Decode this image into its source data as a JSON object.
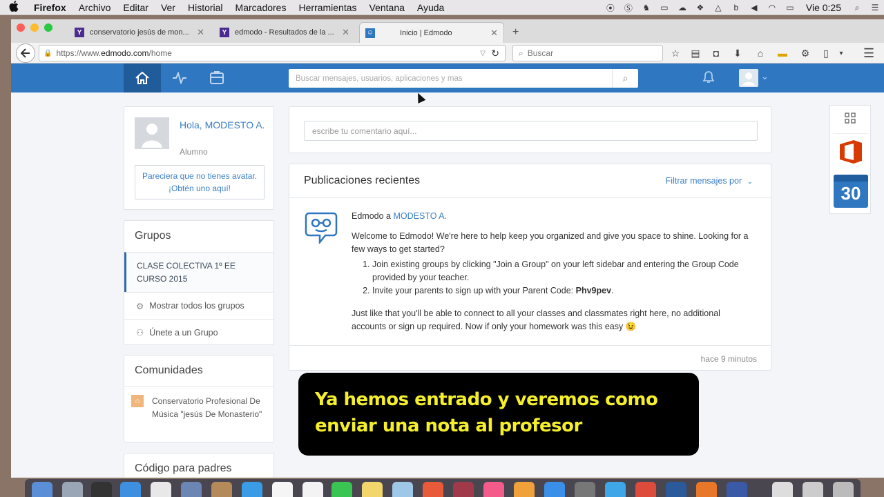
{
  "menubar": {
    "apple": "",
    "items": [
      "Firefox",
      "Archivo",
      "Editar",
      "Ver",
      "Historial",
      "Marcadores",
      "Herramientas",
      "Ventana",
      "Ayuda"
    ],
    "clock": "Vie 0:25"
  },
  "browser": {
    "tabs": [
      {
        "favicon": "Y",
        "title": "conservatorio jesús de mon..."
      },
      {
        "favicon": "Y",
        "title": "edmodo - Resultados de la ..."
      },
      {
        "favicon": "edmodo-icon",
        "title": "Inicio | Edmodo"
      }
    ],
    "new_tab": "+",
    "url_prefix": "https://www.",
    "url_domain": "edmodo.com",
    "url_path": "/home",
    "search_placeholder": "Buscar"
  },
  "edmodo": {
    "search_placeholder": "Buscar mensajes, usuarios, aplicaciones y mas",
    "profile": {
      "greeting": "Hola, MODESTO A.",
      "role": "Alumno",
      "avatar_cta": "Pareciera que no tienes avatar. ¡Obtén uno aquí!"
    },
    "groups": {
      "title": "Grupos",
      "active_group": "CLASE COLECTIVA 1º EE CURSO 2015",
      "show_all": "Mostrar todos los grupos",
      "join": "Únete a un Grupo"
    },
    "communities": {
      "title": "Comunidades",
      "item": "Conservatorio Profesional De Música \"jesús De Monasterio\""
    },
    "parent_code_title": "Código para padres",
    "composer_placeholder": "escribe tu comentario aquí...",
    "feed": {
      "title": "Publicaciones recientes",
      "filter": "Filtrar mensajes por",
      "post": {
        "sender": "Edmodo",
        "to": "a",
        "recipient": "MODESTO A.",
        "intro": "Welcome to Edmodo! We're here to help keep you organized and give you space to shine. Looking for a few ways to get started?",
        "step1": "Join existing groups by clicking \"Join a Group\" on your left sidebar and entering the Group Code provided by your teacher.",
        "step2_text": "Invite your parents to sign up with your Parent Code: ",
        "parent_code": "Phv9pev",
        "step2_end": ".",
        "outro": "Just like that you'll be able to connect to all your classes and classmates right here, no additional accounts or sign up required. Now if only your homework was this easy 😉",
        "time": "hace 9 minutos"
      }
    },
    "calendar_day": "30"
  },
  "subtitle": {
    "line1": "Ya hemos entrado y veremos como",
    "line2": "enviar una nota al profesor"
  },
  "colors": {
    "edmodo_blue": "#2f77c1",
    "link": "#3a7fc4",
    "subtitle": "#f5ef2a",
    "office_red": "#d83b01"
  }
}
